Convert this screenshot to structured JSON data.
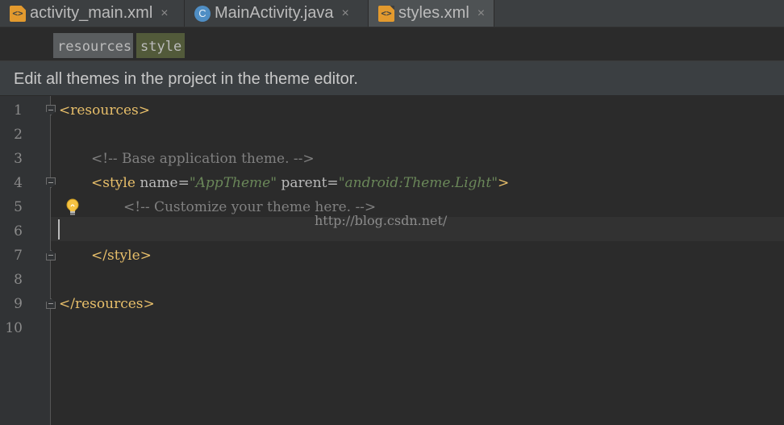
{
  "tabs": [
    {
      "label": "activity_main.xml",
      "icon": "xml-file-icon",
      "icon_glyph": "<>",
      "close": "×",
      "active": false
    },
    {
      "label": "MainActivity.java",
      "icon": "class-icon",
      "icon_glyph": "C",
      "close": "×",
      "active": false
    },
    {
      "label": "styles.xml",
      "icon": "xml-file-icon",
      "icon_glyph": "<>",
      "close": "×",
      "active": true
    }
  ],
  "breadcrumbs": [
    "resources",
    "style"
  ],
  "banner": {
    "text": "Edit all themes in the project in the theme editor."
  },
  "editor": {
    "line_numbers": [
      "1",
      "2",
      "3",
      "4",
      "5",
      "6",
      "7",
      "8",
      "9",
      "10"
    ],
    "current_line": "6",
    "lines": [
      {
        "n": "1",
        "indent": 0,
        "tokens": [
          {
            "t": "tag",
            "v": "<resources>"
          }
        ]
      },
      {
        "n": "2",
        "indent": 0,
        "tokens": []
      },
      {
        "n": "3",
        "indent": 4,
        "tokens": [
          {
            "t": "cmt",
            "v": "<!-- Base application theme. -->"
          }
        ]
      },
      {
        "n": "4",
        "indent": 4,
        "tokens": [
          {
            "t": "tag",
            "v": "<style "
          },
          {
            "t": "attr",
            "v": "name="
          },
          {
            "t": "val",
            "v": "\"AppTheme\""
          },
          {
            "t": "attr",
            "v": " parent="
          },
          {
            "t": "val",
            "v": "\"android:Theme.Light\""
          },
          {
            "t": "tag",
            "v": ">"
          }
        ]
      },
      {
        "n": "5",
        "indent": 8,
        "tokens": [
          {
            "t": "cmt",
            "v": "<!-- Customize your theme here. -->"
          }
        ]
      },
      {
        "n": "6",
        "indent": 0,
        "tokens": []
      },
      {
        "n": "7",
        "indent": 4,
        "tokens": [
          {
            "t": "tag",
            "v": "</style>"
          }
        ]
      },
      {
        "n": "8",
        "indent": 0,
        "tokens": []
      },
      {
        "n": "9",
        "indent": 0,
        "tokens": [
          {
            "t": "tag",
            "v": "</resources>"
          }
        ]
      },
      {
        "n": "10",
        "indent": 0,
        "tokens": []
      }
    ]
  },
  "watermark": "http://blog.csdn.net/",
  "colors": {
    "tag": "#e8bf6a",
    "attribute": "#bababa",
    "value": "#6a8759",
    "comment": "#808080",
    "background": "#2b2b2b",
    "gutter": "#313335"
  },
  "icons": {
    "bulb": "lightbulb-icon"
  }
}
